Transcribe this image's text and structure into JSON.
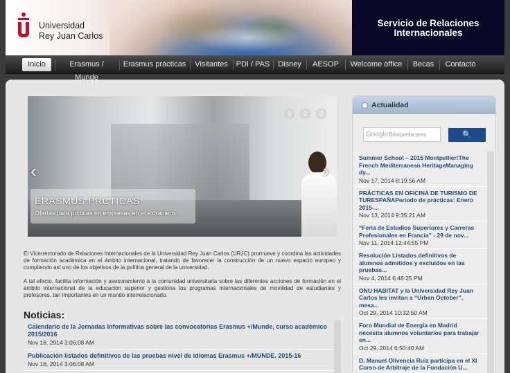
{
  "header": {
    "logo_line1": "Universidad",
    "logo_line2": "Rey Juan Carlos",
    "service_line1": "Servicio de Relaciones",
    "service_line2": "Internacionales"
  },
  "nav": {
    "items": [
      "Inicio",
      "Erasmus / Munde",
      "Erasmus prácticas",
      "Visitantes",
      "PDI / PAS",
      "Disney",
      "AESOP",
      "Welcome office",
      "Becas",
      "Contacto"
    ]
  },
  "slider": {
    "title": "ERASMUS PRCTICAS",
    "subtitle": "Ofertas para prcticas en empresas en el extranjero.",
    "dots": [
      "1",
      "2",
      "3"
    ],
    "prev_arrow": "‹",
    "next_arrow": "›"
  },
  "intro": {
    "p1": "El Vicerrectorado de Relaciones Internacionales de la Universidad Rey Juan Carlos (URJC) promueve y coordina las actividades de formación académica en el ámbito internacional, tratando de favorecer la construcción de un nuevo espacio europeo y cumpliendo así uno de los objetivos de la política general de la universidad.",
    "p2": "A tal efecto, facilita información y asesoramiento a la comunidad universitaria sobre las diferentes acciones de formación en el ámbito internacional de la educación superior y gestiona los programas internacionales de movilidad de estudiantes y profesores, tan importantes en un mundo interrelacionado."
  },
  "noticias": {
    "title": "Noticias:",
    "items": [
      {
        "title": "Calendario de la Jornadas Informativas sobre las convocatorias Erasmus +/Munde, curso académico 2015/2016",
        "date": "Nov 18, 2014 3:06:08 AM"
      },
      {
        "title": "Publicación listados definitivos de las pruebas nivel de idiomas Erasmus +/MUNDE. 2015-16",
        "date": "Nov 18, 2014 3:06:08 AM"
      }
    ]
  },
  "sidebar": {
    "title": "Actualidad",
    "search_placeholder": "Búsqueda pers",
    "google_label": "Google",
    "search_button": "🔍",
    "items": [
      {
        "title": "Summer School – 2015 Montpellier!The French Mediterranean HeritageManaging dy...",
        "date": "Nov 17, 2014 8:19:56 AM"
      },
      {
        "title": "PRÁCTICAS EN OFICINA DE TURISMO DE TURESPAÑAPeriodo de prácticas: Enero 2015-...",
        "date": "Nov 13, 2014 9:35:21 AM"
      },
      {
        "title": "“Feria de Estudios Superiores y Carreras Profesionales en Francia” - 29 de nov...",
        "date": "Nov 11, 2014 12:44:55 PM"
      },
      {
        "title": "Resolución Listados definitivos de alumnos admitidos y excluidos en las pruebas...",
        "date": "Nov 4, 2014 6:48:25 PM"
      },
      {
        "title": "ONU HABITAT y la Universidad Rey Juan Carlos les invitan a “Urban October”, mesa...",
        "date": "Oct 29, 2014 10:32:50 AM"
      },
      {
        "title": "Foro Mundial de Energía en Madrid necesita alumnos voluntarios para trabajar en...",
        "date": "Oct 29, 2014 6:50:40 AM"
      },
      {
        "title": "D. Manuel Olivencia Ruiz participa en el XI Curso de Arbitraje de la Fundación U...",
        "date": ""
      }
    ]
  },
  "colors": {
    "link": "#1e4a7a",
    "search_button": "#1d4a8a",
    "header_dark": "#080826",
    "logo_red": "#c0102a"
  }
}
